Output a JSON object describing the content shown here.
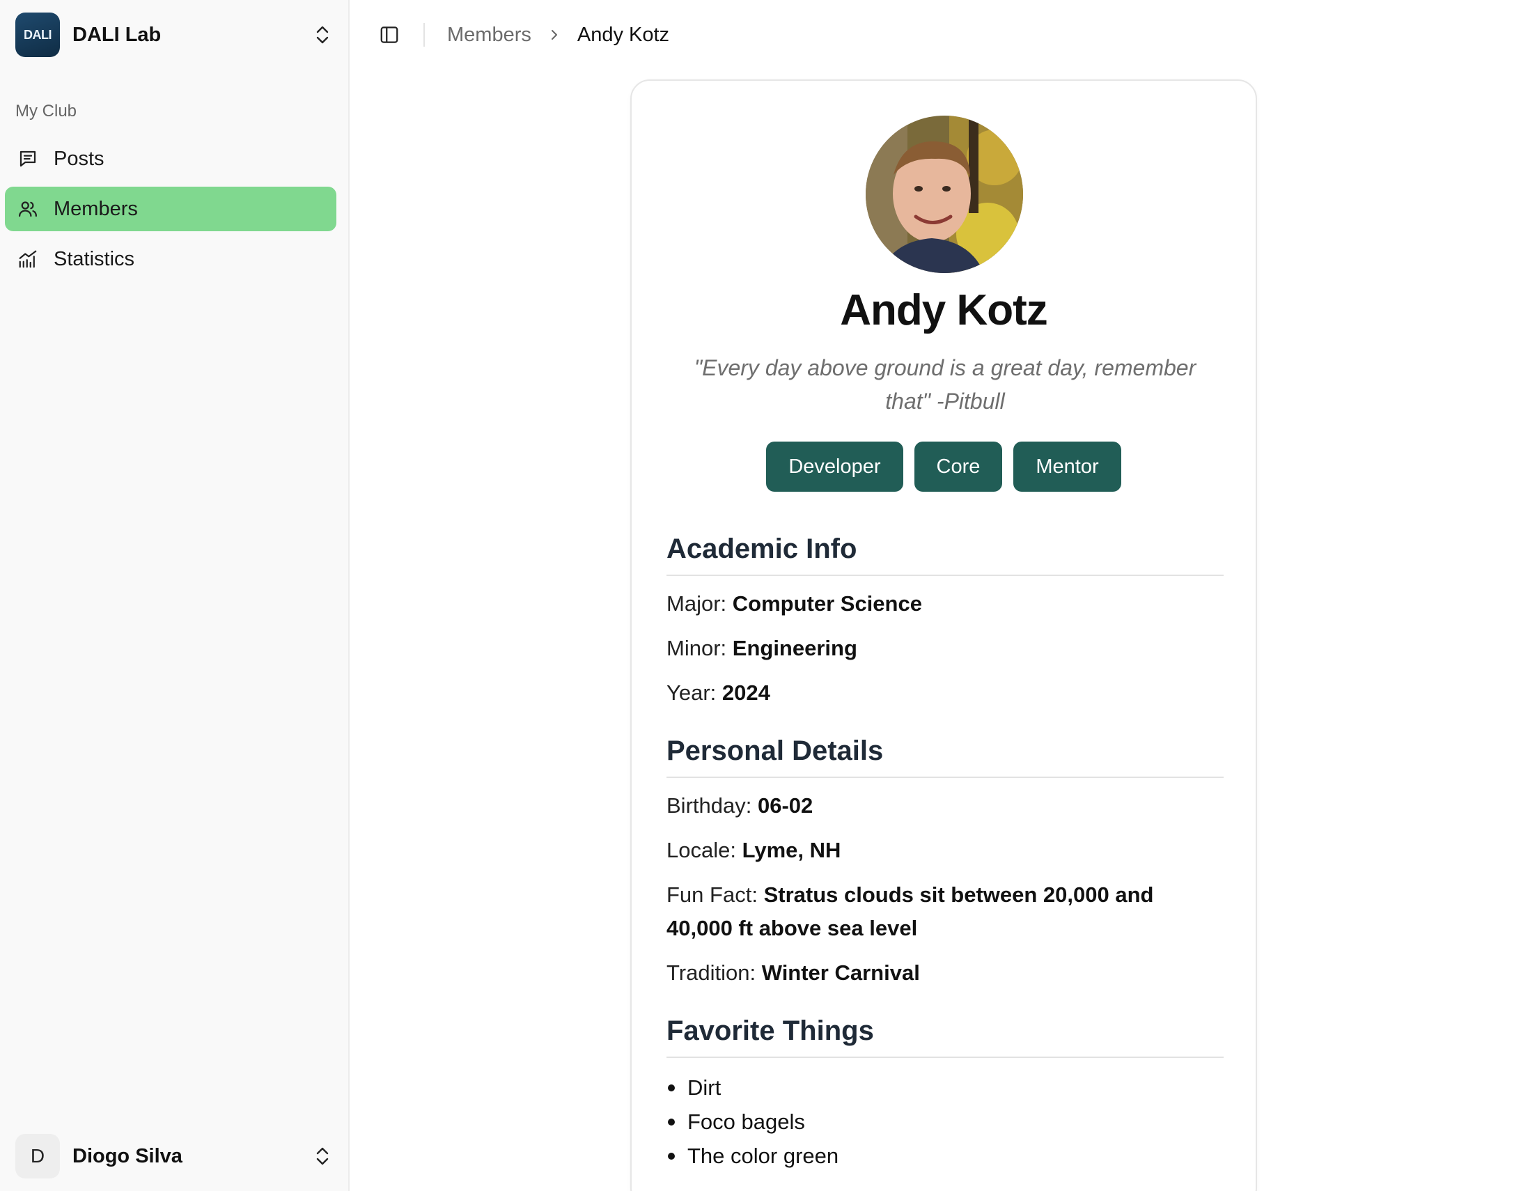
{
  "sidebar": {
    "brand": {
      "logo_text": "DALI",
      "name": "DALI Lab"
    },
    "group_label": "My Club",
    "items": [
      {
        "label": "Posts",
        "icon": "message-square-icon"
      },
      {
        "label": "Members",
        "icon": "users-icon",
        "active": true
      },
      {
        "label": "Statistics",
        "icon": "bar-chart-icon"
      }
    ],
    "user": {
      "initial": "D",
      "name": "Diogo Silva"
    }
  },
  "breadcrumb": {
    "parent": "Members",
    "current": "Andy Kotz"
  },
  "profile": {
    "name": "Andy Kotz",
    "quote": "\"Every day above ground is a great day, remember that\" -Pitbull",
    "tags": [
      "Developer",
      "Core",
      "Mentor"
    ],
    "academic": {
      "title": "Academic Info",
      "major_label": "Major:",
      "major": "Computer Science",
      "minor_label": "Minor:",
      "minor": "Engineering",
      "year_label": "Year:",
      "year": "2024"
    },
    "personal": {
      "title": "Personal Details",
      "birthday_label": "Birthday:",
      "birthday": "06-02",
      "locale_label": "Locale:",
      "locale": "Lyme, NH",
      "funfact_label": "Fun Fact:",
      "funfact": "Stratus clouds sit between 20,000 and 40,000 ft above sea level",
      "tradition_label": "Tradition:",
      "tradition": "Winter Carnival"
    },
    "favorites": {
      "title": "Favorite Things",
      "items": [
        "Dirt",
        "Foco bagels",
        "The color green"
      ]
    }
  },
  "colors": {
    "accent": "#80d88f",
    "tag_bg": "#215d56",
    "heading": "#1f2a37"
  }
}
